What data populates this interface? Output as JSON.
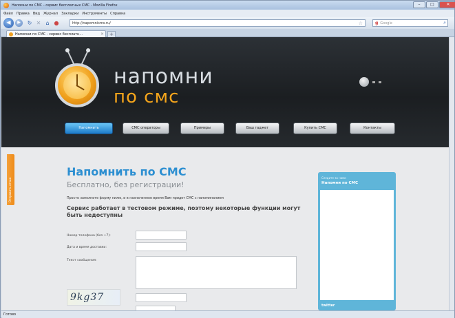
{
  "window": {
    "title": "Напомни по СМС - сервис бесплатных СМС - Mozilla Firefox"
  },
  "menubar": {
    "items": [
      "Файл",
      "Правка",
      "Вид",
      "Журнал",
      "Закладки",
      "Инструменты",
      "Справка"
    ]
  },
  "navbar": {
    "url": "http://napomnisms.ru/",
    "search_engine": "g",
    "search_placeholder": "Google"
  },
  "tabs": [
    {
      "label": "Напомни по СМС - сервис бесплатн..."
    }
  ],
  "site": {
    "brand_line1": "напомни",
    "brand_line2": "по смс",
    "menu": [
      {
        "label": "Напомнить",
        "active": true
      },
      {
        "label": "СМС операторы",
        "active": false
      },
      {
        "label": "Примеры",
        "active": false
      },
      {
        "label": "Ваш гаджет",
        "active": false
      },
      {
        "label": "Купить СМС",
        "active": false
      },
      {
        "label": "Контакты",
        "active": false
      }
    ],
    "feedback_label": "Отправить отзыв"
  },
  "content": {
    "heading": "Напомнить по СМС",
    "subheading": "Бесплатно, без регистрации!",
    "intro": "Просто заполните форму ниже, и в назначенное время Вам придет СМС с напоминанием",
    "warning": "Сервис работает в тестовом режиме, поэтому некоторые функции могут быть недоступны",
    "form": {
      "phone_label": "Номер телефона (без +7):",
      "datetime_label": "Дата и время доставки:",
      "message_label": "Текст сообщения:",
      "captcha_text": "9kg37"
    }
  },
  "widget": {
    "subtitle": "Следите за нами",
    "title": "Напомни по СМС",
    "footer": "twitter"
  },
  "statusbar": {
    "text": "Готово"
  }
}
